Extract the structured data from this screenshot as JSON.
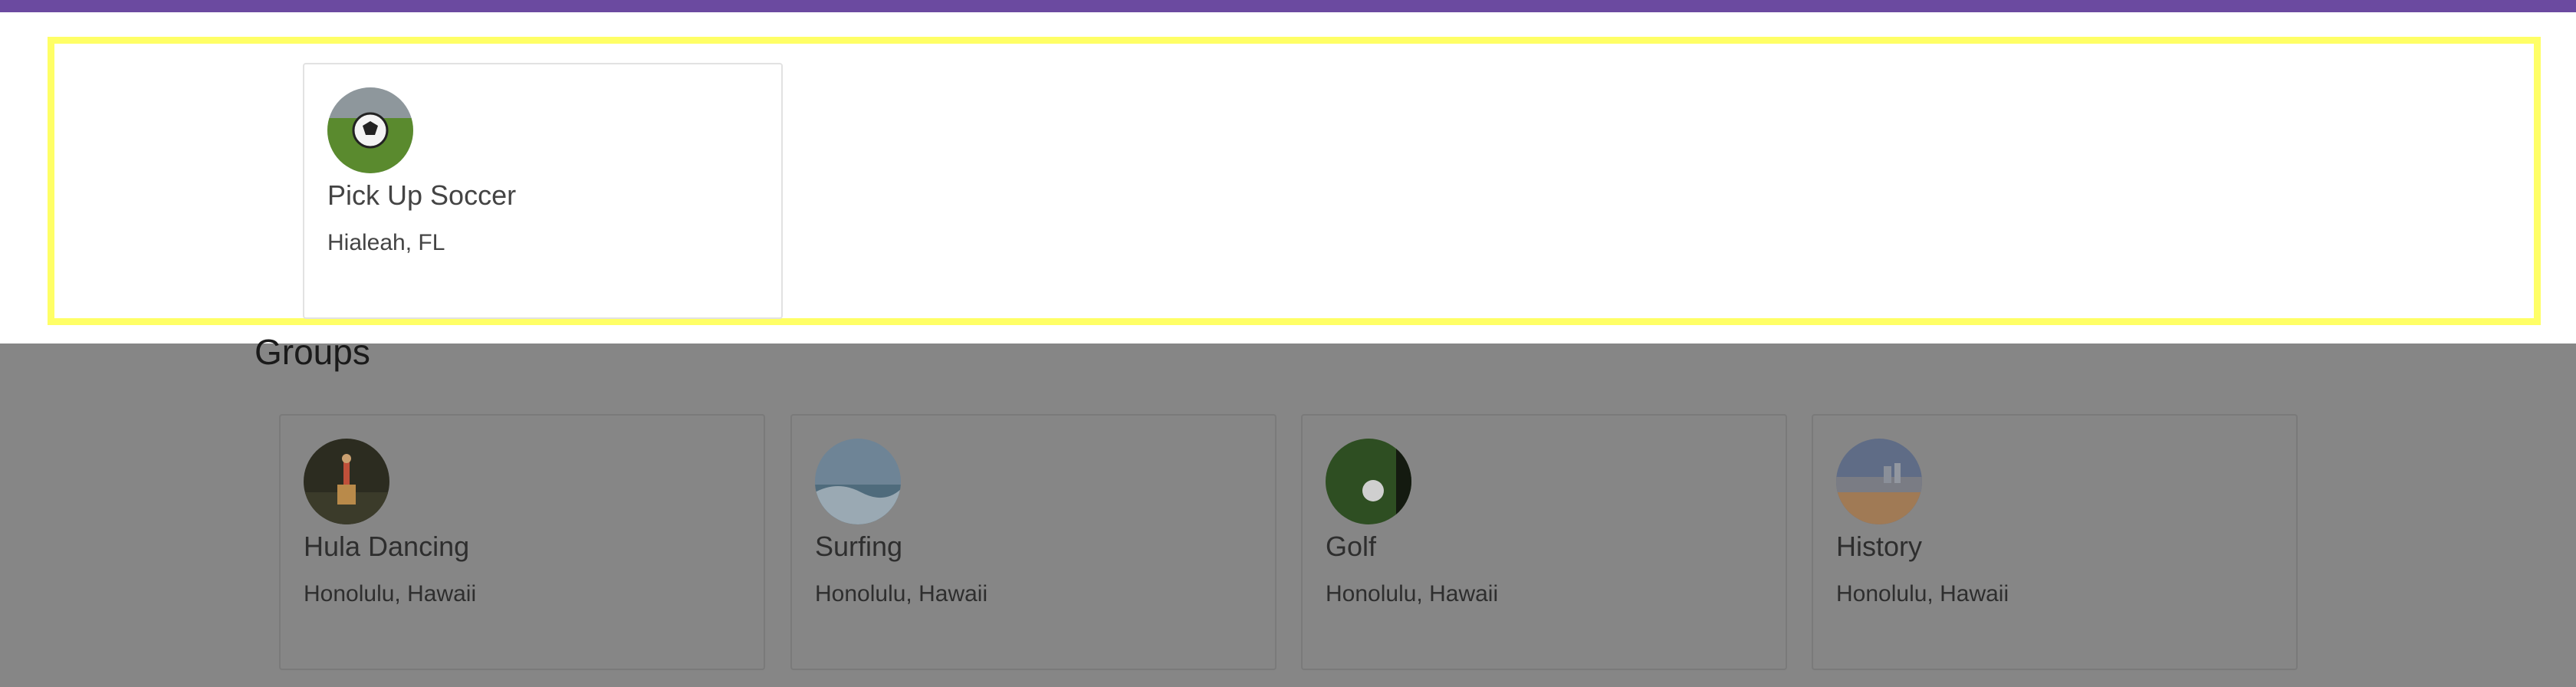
{
  "highlighted_group": {
    "name": "Pick Up Soccer",
    "location": "Hialeah, FL",
    "icon": "soccer-ball-photo"
  },
  "groups_section": {
    "title": "Groups",
    "items": [
      {
        "name": "Hula Dancing",
        "location": "Honolulu, Hawaii",
        "icon": "hula-dancer-photo"
      },
      {
        "name": "Surfing",
        "location": "Honolulu, Hawaii",
        "icon": "wave-photo"
      },
      {
        "name": "Golf",
        "location": "Honolulu, Hawaii",
        "icon": "golf-ball-photo"
      },
      {
        "name": "History",
        "location": "Honolulu, Hawaii",
        "icon": "beach-city-photo"
      }
    ]
  },
  "colors": {
    "topbar": "#6b4aa0",
    "highlight": "#ffff66",
    "overlay": "#868686"
  }
}
